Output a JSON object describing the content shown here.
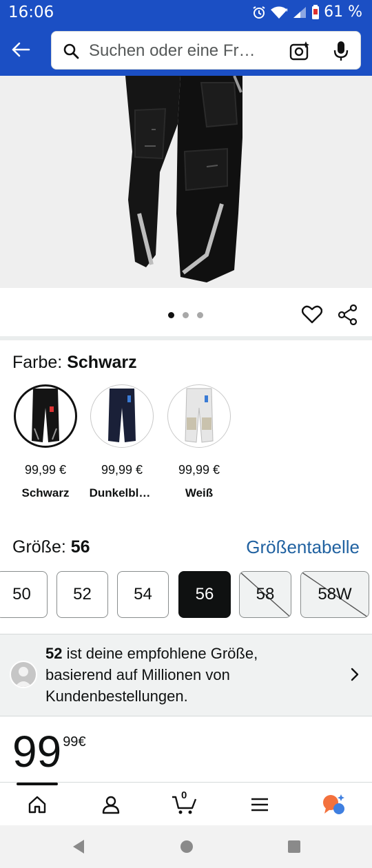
{
  "status_bar": {
    "time": "16:06",
    "battery": "61 %",
    "icons": [
      "alarm-icon",
      "wifi-icon",
      "signal-icon",
      "battery-icon"
    ]
  },
  "header": {
    "back_icon": "arrow-left-icon",
    "search_placeholder": "Suchen oder eine Fr…",
    "camera_icon": "camera-lens-icon",
    "mic_icon": "microphone-icon"
  },
  "gallery": {
    "dot_count": 3,
    "active_dot": 0,
    "heart_icon": "heart-icon",
    "share_icon": "share-icon"
  },
  "color": {
    "label": "Farbe:",
    "selected": "Schwarz",
    "options": [
      {
        "price": "99,99 €",
        "name": "Schwarz",
        "swatch_color": "#141414"
      },
      {
        "price": "99,99 €",
        "name": "Dunkelbl…",
        "swatch_color": "#1a2038"
      },
      {
        "price": "99,99 €",
        "name": "Weiß",
        "swatch_color": "#e6e6e6"
      }
    ]
  },
  "size": {
    "label": "Größe:",
    "selected": "56",
    "size_chart_link": "Größentabelle",
    "options": [
      {
        "label": "50",
        "state": "available"
      },
      {
        "label": "52",
        "state": "available"
      },
      {
        "label": "54",
        "state": "available"
      },
      {
        "label": "56",
        "state": "selected"
      },
      {
        "label": "58",
        "state": "unavailable"
      },
      {
        "label": "58W",
        "state": "unavailable"
      }
    ]
  },
  "recommendation": {
    "size": "52",
    "text_line1": " ist deine empfohlene Größe,",
    "text_line2": "basierend auf Millionen von",
    "text_line3": "Kundenbestellungen."
  },
  "price": {
    "whole": "99",
    "fraction": "99",
    "currency": "€"
  },
  "bottom_nav": {
    "items": [
      "home-icon",
      "account-icon",
      "cart-icon",
      "menu-icon",
      "assistant-icon"
    ],
    "cart_count": "0"
  },
  "colors": {
    "header_blue": "#1b4fc4",
    "link_blue": "#2162a1",
    "assistant_orange": "#f3713d",
    "assistant_blue": "#3f7fe0"
  }
}
